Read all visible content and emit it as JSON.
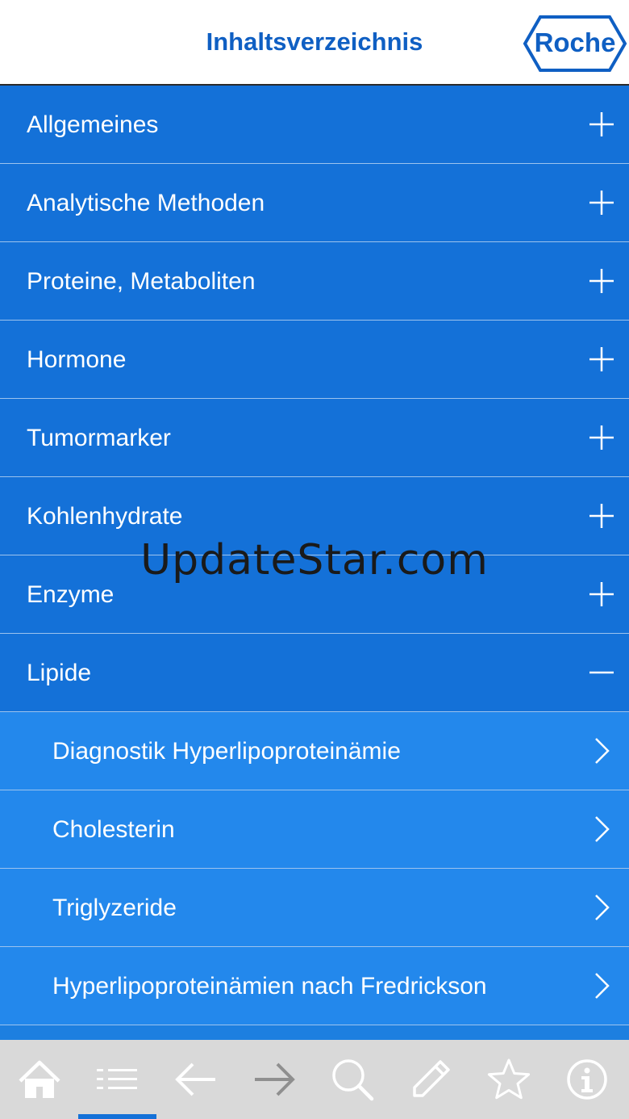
{
  "header": {
    "title": "Inhaltsverzeichnis",
    "logo_text": "Roche"
  },
  "menu": {
    "categories": [
      {
        "label": "Allgemeines",
        "icon": "plus-icon"
      },
      {
        "label": "Analytische Methoden",
        "icon": "plus-icon"
      },
      {
        "label": "Proteine, Metaboliten",
        "icon": "plus-icon"
      },
      {
        "label": "Hormone",
        "icon": "plus-icon"
      },
      {
        "label": "Tumormarker",
        "icon": "plus-icon"
      },
      {
        "label": "Kohlenhydrate",
        "icon": "plus-icon"
      },
      {
        "label": "Enzyme",
        "icon": "plus-icon"
      },
      {
        "label": "Lipide",
        "icon": "minus-icon",
        "expanded": true
      }
    ],
    "lipide_items": [
      {
        "label": "Diagnostik Hyperlipoproteinämie",
        "icon": "chevron-right-icon"
      },
      {
        "label": "Cholesterin",
        "icon": "chevron-right-icon"
      },
      {
        "label": "Triglyzeride",
        "icon": "chevron-right-icon"
      },
      {
        "label": "Hyperlipoproteinämien nach Fredrickson",
        "icon": "chevron-right-icon"
      }
    ]
  },
  "watermark": "UpdateStar.com",
  "bottom_nav": [
    {
      "name": "home",
      "icon": "home-icon"
    },
    {
      "name": "contents",
      "icon": "list-icon",
      "active": true
    },
    {
      "name": "back",
      "icon": "arrow-left-icon"
    },
    {
      "name": "forward",
      "icon": "arrow-right-icon",
      "disabled": true
    },
    {
      "name": "search",
      "icon": "search-icon"
    },
    {
      "name": "notes",
      "icon": "pencil-icon"
    },
    {
      "name": "favorites",
      "icon": "star-icon"
    },
    {
      "name": "info",
      "icon": "info-icon"
    }
  ],
  "colors": {
    "title": "#0f5fc3",
    "category_bg": "#1471d8",
    "subitem_bg": "#2388ec",
    "bottombar_bg": "#d9d9d9",
    "icon_gray": "#8f8f8f",
    "nav_icon": "#ffffff"
  }
}
